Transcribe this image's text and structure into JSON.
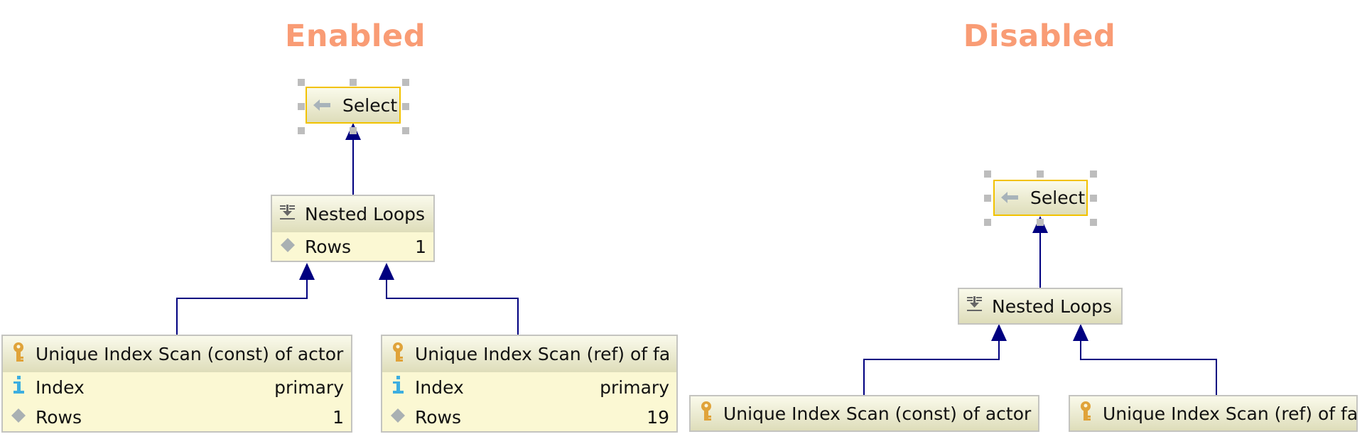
{
  "panels": {
    "enabled": {
      "title": "Enabled",
      "select": {
        "label": "Select"
      },
      "nested_loops": {
        "label": "Nested Loops",
        "rows_label": "Rows",
        "rows_value": "1"
      },
      "scan_left": {
        "label": "Unique Index Scan (const) of actor",
        "index_label": "Index",
        "index_value": "primary",
        "rows_label": "Rows",
        "rows_value": "1"
      },
      "scan_right": {
        "label": "Unique Index Scan (ref) of fa",
        "index_label": "Index",
        "index_value": "primary",
        "rows_label": "Rows",
        "rows_value": "19"
      }
    },
    "disabled": {
      "title": "Disabled",
      "select": {
        "label": "Select"
      },
      "nested_loops": {
        "label": "Nested Loops"
      },
      "scan_left": {
        "label": "Unique Index Scan (const) of actor"
      },
      "scan_right": {
        "label": "Unique Index Scan (ref) of fa"
      }
    }
  },
  "icons": {
    "select": "arrow-left-icon",
    "nested_loops": "nested-loops-icon",
    "scan": "key-icon",
    "index": "info-icon",
    "rows": "diamond-icon"
  },
  "colors": {
    "title": "#F99C75",
    "edge": "#000080",
    "selection_border": "#F2C200",
    "key": "#E0A33A",
    "info": "#3DAEE0",
    "diamond": "#A9B0B3"
  }
}
